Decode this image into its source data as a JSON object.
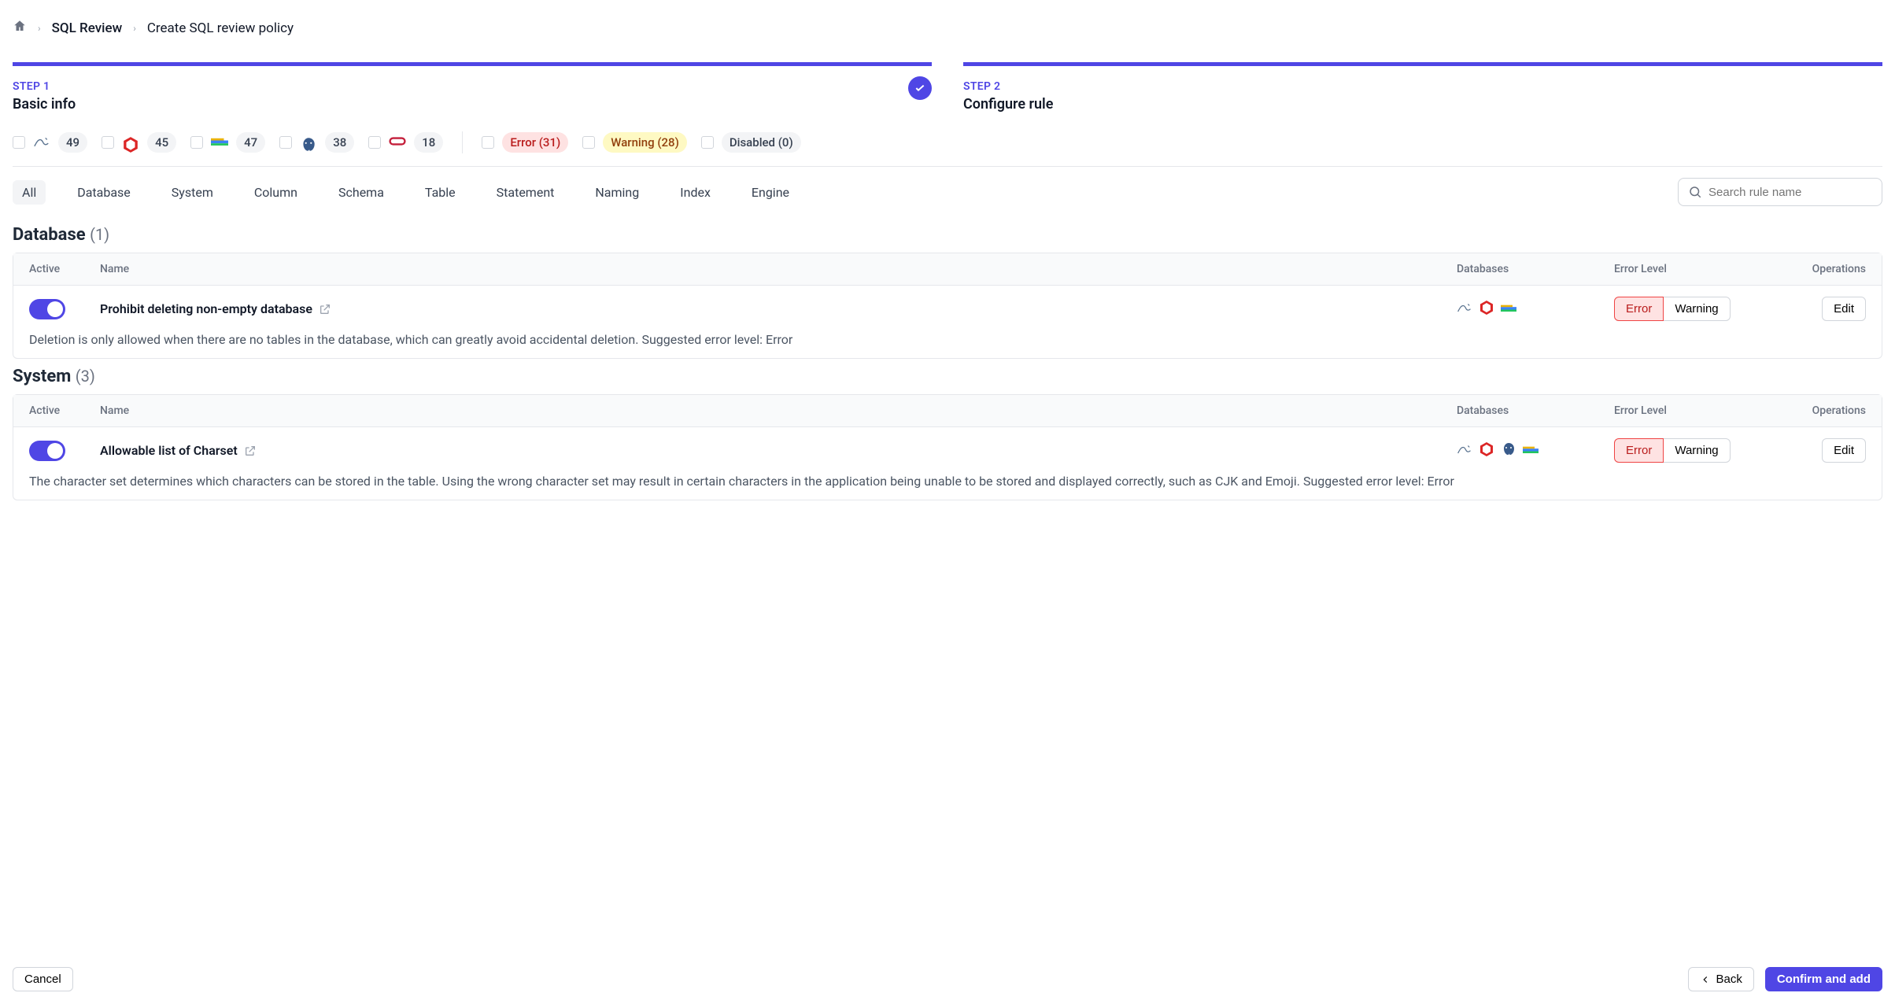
{
  "breadcrumb": {
    "item1": "SQL Review",
    "item2": "Create SQL review policy"
  },
  "steps": {
    "s1": {
      "label": "STEP 1",
      "title": "Basic info"
    },
    "s2": {
      "label": "STEP 2",
      "title": "Configure rule"
    }
  },
  "filters": {
    "engines": [
      {
        "icon": "mysql",
        "count": "49"
      },
      {
        "icon": "tidb",
        "count": "45"
      },
      {
        "icon": "clickhouse",
        "count": "47"
      },
      {
        "icon": "postgres",
        "count": "38"
      },
      {
        "icon": "oracle",
        "count": "18"
      }
    ],
    "levels": {
      "error": "Error (31)",
      "warning": "Warning (28)",
      "disabled": "Disabled (0)"
    }
  },
  "tabs": [
    "All",
    "Database",
    "System",
    "Column",
    "Schema",
    "Table",
    "Statement",
    "Naming",
    "Index",
    "Engine"
  ],
  "search": {
    "placeholder": "Search rule name"
  },
  "headers": {
    "active": "Active",
    "name": "Name",
    "databases": "Databases",
    "level": "Error Level",
    "ops": "Operations"
  },
  "levels": {
    "error": "Error",
    "warning": "Warning"
  },
  "edit": "Edit",
  "sections": {
    "database": {
      "title": "Database",
      "count": "(1)",
      "rules": [
        {
          "name": "Prohibit deleting non-empty database",
          "engines": [
            "mysql",
            "tidb",
            "clickhouse"
          ],
          "selected": "error",
          "desc": "Deletion is only allowed when there are no tables in the database, which can greatly avoid accidental deletion. Suggested error level: Error"
        }
      ]
    },
    "system": {
      "title": "System",
      "count": "(3)",
      "rules": [
        {
          "name": "Allowable list of Charset",
          "engines": [
            "mysql",
            "tidb",
            "postgres",
            "clickhouse"
          ],
          "selected": "error",
          "desc": "The character set determines which characters can be stored in the table. Using the wrong character set may result in certain characters in the application being unable to be stored and displayed correctly, such as CJK and Emoji. Suggested error level: Error"
        }
      ]
    }
  },
  "footer": {
    "cancel": "Cancel",
    "back": "Back",
    "confirm": "Confirm and add"
  }
}
